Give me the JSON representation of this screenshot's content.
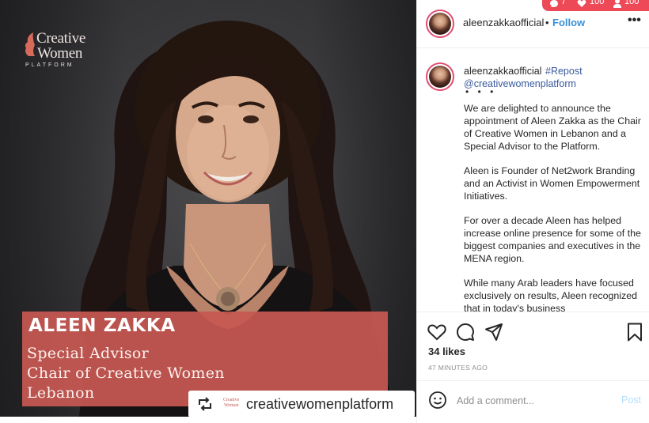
{
  "image": {
    "logo": {
      "line1": "Creative",
      "line2": "Women",
      "line3": "PLATFORM"
    },
    "caption": {
      "name": "ALEEN ZAKKA",
      "line1": "Special Advisor",
      "line2": "Chair of Creative Women",
      "line3": "Lebanon"
    },
    "repost_tag": {
      "logo_line1": "Creative",
      "logo_line2": "Women",
      "handle": "creativewomenplatform"
    }
  },
  "header": {
    "username": "aleenzakkaofficial",
    "separator": "•",
    "follow_label": "Follow",
    "more_label": "•••"
  },
  "notifications": {
    "first": "7",
    "second": "100",
    "third": "100"
  },
  "post_caption": {
    "username": "aleenzakkaofficial",
    "hashtag": "#Repost",
    "mention": "@creativewomenplatform",
    "dots": "• • •",
    "paragraphs": [
      "We are delighted to announce the appointment of Aleen Zakka as the Chair of Creative Women in Lebanon and a Special Advisor to the Platform.",
      "Aleen is Founder of Net2work Branding and an Activist in Women Empowerment Initiatives.",
      "For over a decade Aleen has helped increase online presence for some of the biggest companies and executives in the MENA region.",
      "While many Arab leaders have focused exclusively on results, Aleen recognized that in today's business"
    ]
  },
  "actions": {
    "likes": "34 likes",
    "timestamp": "47 MINUTES AGO"
  },
  "comment": {
    "placeholder": "Add a comment...",
    "post_label": "Post"
  },
  "colors": {
    "accent": "#3a8fd6",
    "caption_box": "#c75852",
    "notif": "#ed4956",
    "link": "#3a5a9b"
  }
}
